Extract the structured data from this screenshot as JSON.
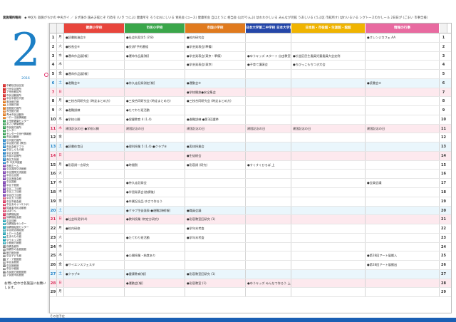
{
  "legend_strip": {
    "title": "実施場所略称",
    "text": "◆ 中区ち 鉄施がちかの 中央がイ ／ まず誰の 施み方館とぞ 行政を (いき つにぶ) 健康所を ろうなおにしいる 青民会 (ユース) 健康所会 自ほとうに 相当会 (はがりんぶ) 幼わわかしいる みんなが児館 うあしいる (うぶ区 市館所す) 幼わいるいる シグトースのかしール 2日日が (ごまい 市事全様）"
  },
  "sidebar": {
    "month": "2",
    "year": "2016",
    "legend_items": [
      {
        "key": "①",
        "label": "中観世田谷区宮",
        "color": "#d62b2b"
      },
      {
        "key": "②",
        "label": "日世中区館所",
        "color": "#d62b2b"
      },
      {
        "key": "③",
        "label": "ア世田館区所",
        "color": "#d62b2b"
      },
      {
        "key": "④",
        "label": "市民活動館所",
        "color": "#d62b2b"
      },
      {
        "key": "⑤",
        "label": "中区中館世代館",
        "color": "#d62b2b"
      },
      {
        "key": "⑥",
        "label": "奥永館方館",
        "color": "#e07a1e"
      },
      {
        "key": "⑦",
        "label": "上田館方館",
        "color": "#e07a1e"
      },
      {
        "key": "⑧",
        "label": "宮館館方館所",
        "color": "#e07a1e"
      },
      {
        "key": "⑨",
        "label": "市田館方館",
        "color": "#e07a1e"
      },
      {
        "key": "⑩",
        "label": "青木市民活動所",
        "color": "#e07a1e"
      },
      {
        "key": "⑪",
        "label": "ハローき館情報館",
        "color": "#e07a1e"
      },
      {
        "key": "⑫",
        "label": "上田館健康センター",
        "color": "#2a9a4a"
      },
      {
        "key": "⑬",
        "label": "あさひ健康館館",
        "color": "#2a9a4a"
      },
      {
        "key": "⑭",
        "label": "市民館方館所",
        "color": "#2a9a4a"
      },
      {
        "key": "⑮",
        "label": "センター",
        "color": "#2a9a4a"
      },
      {
        "key": "⑯",
        "label": "センタータ世代情報館",
        "color": "#2a9a4a"
      },
      {
        "key": "⑰",
        "label": "市民活動館",
        "color": "#2a9a4a"
      },
      {
        "key": "⑱",
        "label": "世代館方館所",
        "color": "#1c7fc5"
      },
      {
        "key": "⑲",
        "label": "中区館方館 (教官)",
        "color": "#1c7fc5"
      },
      {
        "key": "⑳",
        "label": "市民会館アプラ",
        "color": "#1c7fc5"
      },
      {
        "key": "㉑",
        "label": "中区しんもの館",
        "color": "#1c7fc5"
      },
      {
        "key": "㉒",
        "label": "中区文化館",
        "color": "#1c7fc5"
      },
      {
        "key": "㉓",
        "label": "市民の会館所",
        "color": "#1c7fc5"
      },
      {
        "key": "㉔",
        "label": "南区文化館",
        "color": "#1c7fc5"
      },
      {
        "key": "㉕",
        "label": "市 中央市館館",
        "color": "#1c7fc5"
      },
      {
        "key": "㉖",
        "label": "市館ホーム",
        "color": "#7a3fb0"
      },
      {
        "key": "㉗",
        "label": "中区国際交流館館",
        "color": "#7a3fb0"
      },
      {
        "key": "㉘",
        "label": "中区国際交流館館",
        "color": "#7a3fb0"
      },
      {
        "key": "㉙",
        "label": "中区山区館",
        "color": "#7a3fb0"
      },
      {
        "key": "㉚",
        "label": "中区音楽会館",
        "color": "#7a3fb0"
      },
      {
        "key": "㉛",
        "label": "中区図館",
        "color": "#7a3fb0"
      },
      {
        "key": "㉜",
        "label": "中区下館館",
        "color": "#7a3fb0"
      },
      {
        "key": "㉝",
        "label": "中区二丁目館",
        "color": "#7a3fb0"
      },
      {
        "key": "㉞",
        "label": "中区三丁目館",
        "color": "#7a3fb0"
      },
      {
        "key": "㉟",
        "label": "中区四丁目館",
        "color": "#7a3fb0"
      },
      {
        "key": "㊱",
        "label": "中区五丁目館",
        "color": "#d6305a"
      },
      {
        "key": "㊲",
        "label": "中区市館会館",
        "color": "#d6305a"
      },
      {
        "key": "㊳",
        "label": "中区あみ (ハロラボ)",
        "color": "#d6305a"
      },
      {
        "key": "㊴",
        "label": "障害者市民活動館",
        "color": "#d6305a"
      },
      {
        "key": "㊵",
        "label": "ぽぽりん",
        "color": "#d6305a"
      },
      {
        "key": "㊶",
        "label": "保健福祉館",
        "color": "#d6305a"
      },
      {
        "key": "㊷",
        "label": "保健福祉会館",
        "color": "#d6305a"
      },
      {
        "key": "㊸",
        "label": "中区体館",
        "color": "#1a9fb0"
      },
      {
        "key": "㊹",
        "label": "保健福祉センター",
        "color": "#1a9fb0"
      },
      {
        "key": "㊺",
        "label": "保健福祉館センター",
        "color": "#1a9fb0"
      },
      {
        "key": "㊻",
        "label": "中区総合福祉館",
        "color": "#1a9fb0"
      },
      {
        "key": "㊼",
        "label": "トロール会館",
        "color": "#1a9fb0"
      },
      {
        "key": "㊽",
        "label": "生まれもの館",
        "color": "#1a9fb0"
      },
      {
        "key": "㊾",
        "label": "ゆうキッズ館",
        "color": "#1a9fb0"
      },
      {
        "key": "㊿",
        "label": "小館館方館館",
        "color": "#1a9fb0"
      },
      {
        "key": "51",
        "label": "保健会館所",
        "color": "#888888"
      },
      {
        "key": "52",
        "label": "保健所の会館館館",
        "color": "#888888"
      },
      {
        "key": "53",
        "label": "館方館社館",
        "color": "#888888"
      },
      {
        "key": "54",
        "label": "中区子ども館",
        "color": "#888888"
      },
      {
        "key": "55",
        "label": "ア・ア館館館",
        "color": "#888888"
      },
      {
        "key": "56",
        "label": "中区会館館",
        "color": "#888888"
      },
      {
        "key": "57",
        "label": "中区館館館",
        "color": "#888888"
      },
      {
        "key": "58",
        "label": "中区ゆ館館",
        "color": "#888888"
      },
      {
        "key": "59",
        "label": "お民館方館館館館",
        "color": "#888888"
      },
      {
        "key": "60",
        "label": "ア民館市民館館",
        "color": "#888888"
      }
    ],
    "inquiry": "お問い合わせ各施設にお願いします。"
  },
  "calendar": {
    "headers": [
      {
        "label": "健康小学校",
        "color": "#e8453c"
      },
      {
        "label": "市民小学校",
        "color": "#3aa64a"
      },
      {
        "label": "市国小学校",
        "color": "#e07a1e"
      },
      {
        "label": "日本大学第二中学校 日本大学第一高等学校",
        "color": "#2446a8"
      },
      {
        "label": "日本民・市役館・生涯館・館館",
        "color": "#f0b400"
      },
      {
        "label": "情報の行事",
        "color": "#e86aa0"
      }
    ],
    "rows": [
      {
        "date": "1",
        "wd": "月",
        "type": "",
        "cells": [
          "●読書推進会③",
          "●社会科見学5 (7/8)",
          "●校内研究会",
          "",
          "",
          "●オレンジカフェ AA"
        ]
      },
      {
        "date": "2",
        "wd": "火",
        "type": "",
        "cells": [
          "●校長会④",
          "●交流F予約番組",
          "●学芸発表会(準備)",
          "",
          "",
          ""
        ]
      },
      {
        "date": "3",
        "wd": "水",
        "type": "",
        "cells": [
          "●運命作品展[報]",
          "●運命作品展[報]",
          "●学芸発表会(東京・準備)",
          "●ゆうキッズ スタート 自由教室",
          "●杉並区民生委員児童委員大会定例",
          ""
        ]
      },
      {
        "date": "4",
        "wd": "木",
        "type": "",
        "cells": [
          "",
          "",
          "●学芸発表会(東京)",
          "●子育て講演会",
          "●ちびっこもちつき大会",
          ""
        ]
      },
      {
        "date": "5",
        "wd": "金",
        "type": "",
        "cells": [
          "●運命作品展[報]",
          "",
          "",
          "",
          "",
          ""
        ]
      },
      {
        "date": "6",
        "wd": "土",
        "type": "sat",
        "cells": [
          "●避難会④",
          "●持久走記録測定[報]",
          "●運動会④",
          "",
          "",
          "●読書会②"
        ]
      },
      {
        "date": "7",
        "wd": "日",
        "type": "sun",
        "cells": [
          "",
          "",
          "●学校開放●安全集会",
          "",
          "",
          ""
        ]
      },
      {
        "date": "8",
        "wd": "月",
        "type": "",
        "cells": [
          "●三校合同研究会 (時定まとめ方)",
          "●三校合同研究会 (時定まとめ方)",
          "●三校合同研究会 (時定まとめ方)",
          "",
          "",
          ""
        ]
      },
      {
        "date": "9",
        "wd": "火",
        "type": "",
        "cells": [
          "●避難訓練",
          "●たてわり班活動",
          "",
          "",
          "",
          ""
        ]
      },
      {
        "date": "10",
        "wd": "水",
        "type": "",
        "cells": [
          "●学校公開",
          "●保健教育 4 (1.4)",
          "●避難訓練 ●第3回選挙",
          "",
          "",
          ""
        ]
      },
      {
        "date": "11",
        "wd": "木",
        "type": "sun",
        "cells": [
          "建国記念の日 ●学校公開",
          "建国記念の日",
          "建国記念の日",
          "建国記念の日",
          "建国記念の日",
          "建国記念の日"
        ]
      },
      {
        "date": "12",
        "wd": "金",
        "type": "",
        "cells": [
          "",
          "",
          "",
          "",
          "",
          ""
        ]
      },
      {
        "date": "13",
        "wd": "土",
        "type": "sat",
        "cells": [
          "●読書体育日",
          "●理科授業 5 (1.4) ●クラブ⑨",
          "●実体授業会",
          "",
          "",
          ""
        ]
      },
      {
        "date": "14",
        "wd": "日",
        "type": "sun",
        "cells": [
          "",
          "",
          "●生徒総会",
          "",
          "",
          ""
        ]
      },
      {
        "date": "15",
        "wd": "月",
        "type": "",
        "cells": [
          "●形容詞一言研究",
          "●時間割",
          "●形容詞 (研究)",
          "●すくすくひろば 上",
          "",
          ""
        ]
      },
      {
        "date": "16",
        "wd": "火",
        "type": "",
        "cells": [
          "",
          "",
          "",
          "",
          "",
          ""
        ]
      },
      {
        "date": "17",
        "wd": "水",
        "type": "",
        "cells": [
          "",
          "●持久走記録会",
          "",
          "",
          "",
          "●会員会議"
        ]
      },
      {
        "date": "18",
        "wd": "木",
        "type": "",
        "cells": [
          "",
          "●学習発表会(放課後)",
          "",
          "",
          "",
          ""
        ]
      },
      {
        "date": "19",
        "wd": "金",
        "type": "",
        "cells": [
          "",
          "●卒業記念品 ゆさで作ろう",
          "",
          "",
          "",
          ""
        ]
      },
      {
        "date": "20",
        "wd": "土",
        "type": "sat",
        "cells": [
          "",
          "●クラブ生徒発表 ●避難訓練[報]",
          "●職員会議",
          "",
          "",
          ""
        ]
      },
      {
        "date": "21",
        "wd": "日",
        "type": "sun",
        "cells": [
          "●社会科見学(4)",
          "●教科授業 (特定方研究)",
          "●形容教室回研究 (1)",
          "",
          "",
          ""
        ]
      },
      {
        "date": "22",
        "wd": "月",
        "type": "",
        "cells": [
          "●校内研修",
          "",
          "●学年末考査",
          "",
          "",
          ""
        ]
      },
      {
        "date": "23",
        "wd": "火",
        "type": "",
        "cells": [
          "",
          "●たてわり班活動",
          "●学年末考査",
          "",
          "",
          ""
        ]
      },
      {
        "date": "24",
        "wd": "水",
        "type": "",
        "cells": [
          "",
          "",
          "",
          "",
          "",
          ""
        ]
      },
      {
        "date": "25",
        "wd": "木",
        "type": "",
        "cells": [
          "",
          "●公開授業・給食あり",
          "",
          "",
          "",
          "●第28回アート展搬入"
        ]
      },
      {
        "date": "26",
        "wd": "金",
        "type": "",
        "cells": [
          "●サイエンスフェスタ",
          "",
          "",
          "",
          "",
          "●第28回アート展搬出"
        ]
      },
      {
        "date": "27",
        "wd": "土",
        "type": "sat",
        "cells": [
          "●クラブ⑨",
          "●健康教育[報]",
          "●形容教室回研究 (1)",
          "",
          "",
          ""
        ]
      },
      {
        "date": "28",
        "wd": "日",
        "type": "sun",
        "cells": [
          "",
          "●運動会[報]",
          "●形容教室 (1)",
          "●ゆうキッズ みんなで作ろう 上",
          "",
          ""
        ]
      },
      {
        "date": "29",
        "wd": "月",
        "type": "",
        "cells": [
          "",
          "",
          "",
          "",
          "",
          ""
        ]
      }
    ]
  },
  "footer_note": "その他予定"
}
